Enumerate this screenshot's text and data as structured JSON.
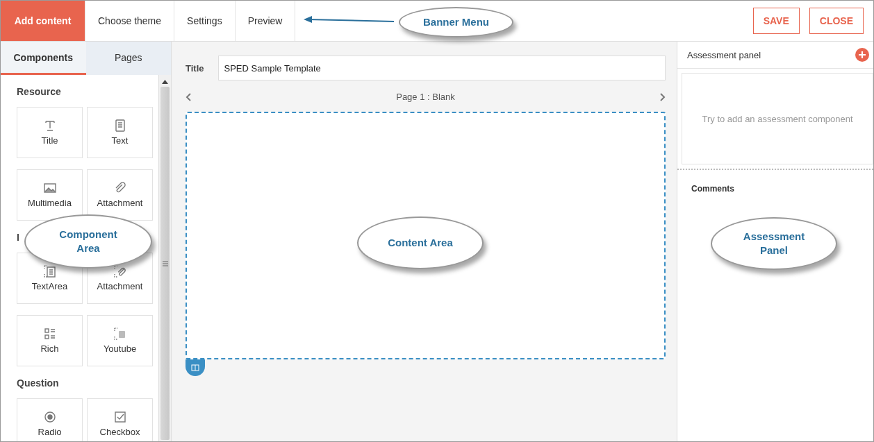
{
  "header": {
    "tabs": [
      {
        "label": "Add content",
        "selected": true
      },
      {
        "label": "Choose theme",
        "selected": false
      },
      {
        "label": "Settings",
        "selected": false
      },
      {
        "label": "Preview",
        "selected": false
      }
    ],
    "buttons": [
      "SAVE",
      "CLOSE"
    ]
  },
  "sidebar": {
    "tabs": [
      {
        "label": "Components",
        "selected": true
      },
      {
        "label": "Pages",
        "selected": false
      }
    ],
    "sections": [
      {
        "heading": "Resource",
        "items": [
          {
            "label": "Title",
            "kind": "title"
          },
          {
            "label": "Text",
            "kind": "text"
          },
          {
            "label": "Multimedia",
            "kind": "image"
          },
          {
            "label": "Attachment",
            "kind": "clip"
          }
        ]
      },
      {
        "heading": "I",
        "items": [
          {
            "label": "TextArea",
            "kind": "textarea"
          },
          {
            "label": "Attachment",
            "kind": "clipbox"
          },
          {
            "label": "Rich",
            "kind": "rich"
          },
          {
            "label": "Youtube",
            "kind": "video"
          }
        ]
      },
      {
        "heading": "Question",
        "items": [
          {
            "label": "Radio",
            "kind": "radio"
          },
          {
            "label": "Checkbox",
            "kind": "check"
          }
        ]
      }
    ]
  },
  "editor": {
    "title_label": "Title",
    "title_value": "SPED Sample Template",
    "page_label": "Page 1 : Blank"
  },
  "assessment": {
    "title": "Assessment panel",
    "placeholder": "Try to add an assessment component",
    "comments_label": "Comments"
  },
  "callouts": [
    {
      "kind": "banner",
      "text": "Banner Menu"
    },
    {
      "kind": "components",
      "text": "Component Area"
    },
    {
      "kind": "content",
      "text": "Content Area"
    },
    {
      "kind": "assessment",
      "text": "Assessment Panel"
    }
  ]
}
